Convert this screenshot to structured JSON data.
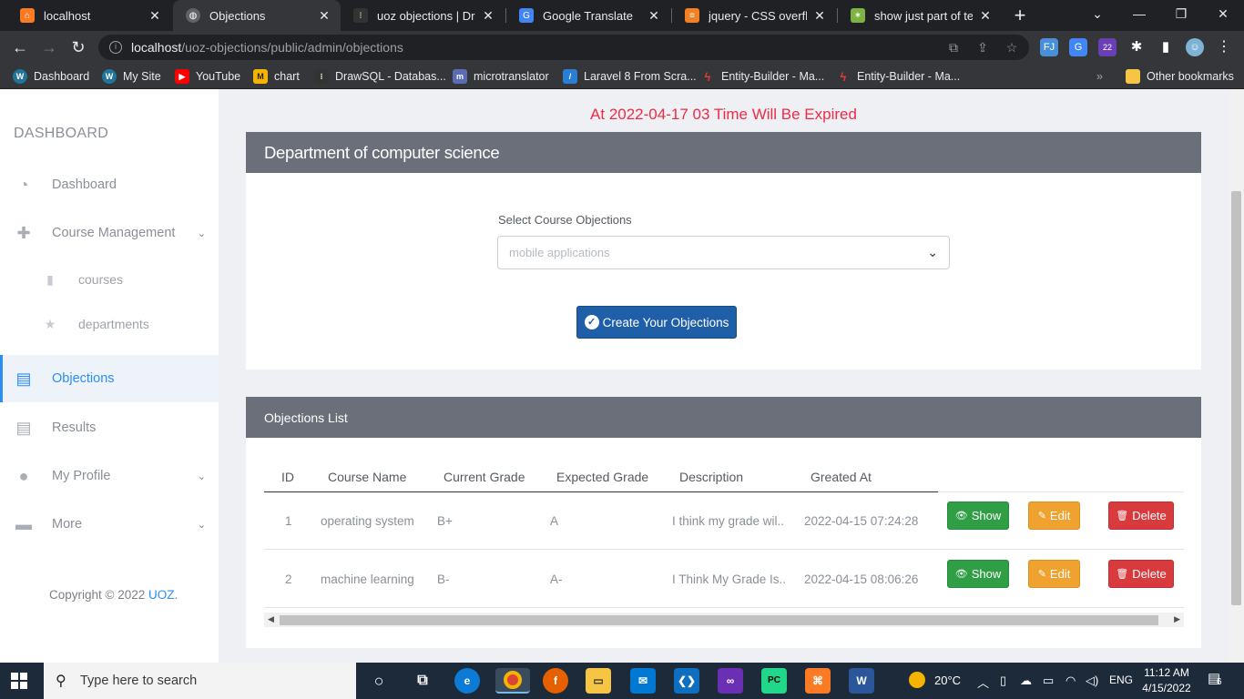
{
  "browser": {
    "tabs": [
      {
        "label": "localhost",
        "icon": "xampp",
        "color": "#fb7a24",
        "active": false
      },
      {
        "label": "Objections",
        "icon": "globe",
        "color": "#9aa0a6",
        "active": true
      },
      {
        "label": "uoz objections | DrawS",
        "icon": "drawsql",
        "color": "#333",
        "active": false
      },
      {
        "label": "Google Translate",
        "icon": "translate",
        "color": "#4285f4",
        "active": false
      },
      {
        "label": "jquery - CSS overflow",
        "icon": "stackoverflow",
        "color": "#f48024",
        "active": false
      },
      {
        "label": "show just part of text",
        "icon": "star",
        "color": "#7cb342",
        "active": false
      }
    ],
    "new_tab_symbol": "+",
    "window_buttons": {
      "minimize": "—",
      "restore": "❐",
      "close": "✕",
      "tab_list": "⌄"
    },
    "url_host": "localhost",
    "url_path": "/uoz-objections/public/admin/objections",
    "bookmarks": [
      {
        "label": "Dashboard",
        "icon": "W",
        "color": "#21759b"
      },
      {
        "label": "My Site",
        "icon": "W",
        "color": "#21759b"
      },
      {
        "label": "YouTube",
        "icon": "▶",
        "color": "#ff0000"
      },
      {
        "label": "chart",
        "icon": "M",
        "color": "#f5b400"
      },
      {
        "label": "DrawSQL - Databas...",
        "icon": ":",
        "color": "#333"
      },
      {
        "label": "microtranslator",
        "icon": "m",
        "color": "#5b6cb5"
      },
      {
        "label": "Laravel 8 From Scra...",
        "icon": "/",
        "color": "#2a7fd4"
      },
      {
        "label": "Entity-Builder - Ma...",
        "icon": "⚡",
        "color": "#e53935"
      },
      {
        "label": "Entity-Builder - Ma...",
        "icon": "⚡",
        "color": "#e53935"
      }
    ],
    "bookmarks_overflow": "»",
    "other_bookmarks": "Other bookmarks",
    "extension_badge": "22"
  },
  "sidebar": {
    "title": "DASHBOARD",
    "items": [
      {
        "label": "Dashboard",
        "icon": "gauge-icon",
        "glyph": "◔"
      },
      {
        "label": "Course Management",
        "icon": "plus-square-icon",
        "glyph": "✚",
        "chevron": "⌄"
      },
      {
        "label": "Objections",
        "icon": "table-icon",
        "glyph": "▤",
        "active": true
      },
      {
        "label": "Results",
        "icon": "table-icon",
        "glyph": "▤"
      },
      {
        "label": "My Profile",
        "icon": "user-icon",
        "glyph": "●",
        "chevron": "⌄"
      },
      {
        "label": "More",
        "icon": "keyboard-icon",
        "glyph": "▬",
        "chevron": "⌄"
      }
    ],
    "subitems": [
      {
        "label": "courses",
        "icon": "book-icon",
        "glyph": "▮"
      },
      {
        "label": "departments",
        "icon": "star-icon",
        "glyph": "★"
      }
    ],
    "copyright_prefix": "Copyright © 2022 ",
    "copyright_link": "UOZ",
    "copyright_suffix": "."
  },
  "main": {
    "expired_notice": "At 2022-04-17 03 Time Will Be Expired",
    "form_card": {
      "title": "Department of computer science",
      "select_label": "Select Course Objections",
      "select_value": "mobile applications",
      "create_button": "Create Your Objections"
    },
    "list_card": {
      "title": "Objections List",
      "columns": [
        "ID",
        "Course Name",
        "Current Grade",
        "Expected Grade",
        "Description",
        "Greated At"
      ],
      "rows": [
        {
          "id": "1",
          "course": "operating system",
          "current": "B+",
          "expected": "A",
          "description": "I think my grade wil..",
          "created": "2022-04-15 07:24:28"
        },
        {
          "id": "2",
          "course": "machine learning",
          "current": "B-",
          "expected": "A-",
          "description": "I Think My Grade Is..",
          "created": "2022-04-15 08:06:26"
        }
      ],
      "actions": {
        "show": "Show",
        "edit": "Edit",
        "delete": "Delete"
      }
    }
  },
  "taskbar": {
    "search_placeholder": "Type here to search",
    "temperature": "20°C",
    "language": "ENG",
    "time": "11:12 AM",
    "date": "4/15/2022",
    "notification_count": "6"
  }
}
